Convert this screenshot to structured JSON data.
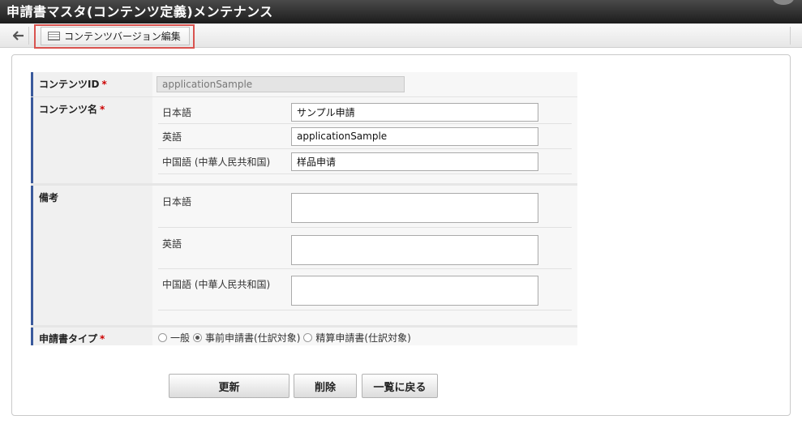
{
  "window": {
    "title": "申請書マスタ(コンテンツ定義)メンテナンス"
  },
  "toolbar": {
    "back_icon": "arrow-left-icon",
    "tab_label": "コンテンツバージョン編集",
    "tab_icon": "list-icon"
  },
  "form": {
    "content_id": {
      "label": "コンテンツID",
      "required": "*",
      "value": "applicationSample"
    },
    "content_name": {
      "label": "コンテンツ名",
      "required": "*",
      "rows": [
        {
          "lang": "日本語",
          "value": "サンプル申請"
        },
        {
          "lang": "英語",
          "value": "applicationSample"
        },
        {
          "lang": "中国語 (中華人民共和国)",
          "value": "样品申请"
        }
      ]
    },
    "remarks": {
      "label": "備考",
      "rows": [
        {
          "lang": "日本語",
          "value": ""
        },
        {
          "lang": "英語",
          "value": ""
        },
        {
          "lang": "中国語 (中華人民共和国)",
          "value": ""
        }
      ]
    },
    "app_type": {
      "label": "申請書タイプ",
      "required": "*",
      "options": [
        "一般",
        "事前申請書(仕訳対象)",
        "精算申請書(仕訳対象)"
      ],
      "selected": "事前申請書(仕訳対象)"
    }
  },
  "buttons": {
    "update": "更新",
    "delete": "削除",
    "back_to_list": "一覧に戻る"
  },
  "colors": {
    "accent_border": "#3a5a9c",
    "required": "#cc0000",
    "highlight": "#d9534f"
  }
}
